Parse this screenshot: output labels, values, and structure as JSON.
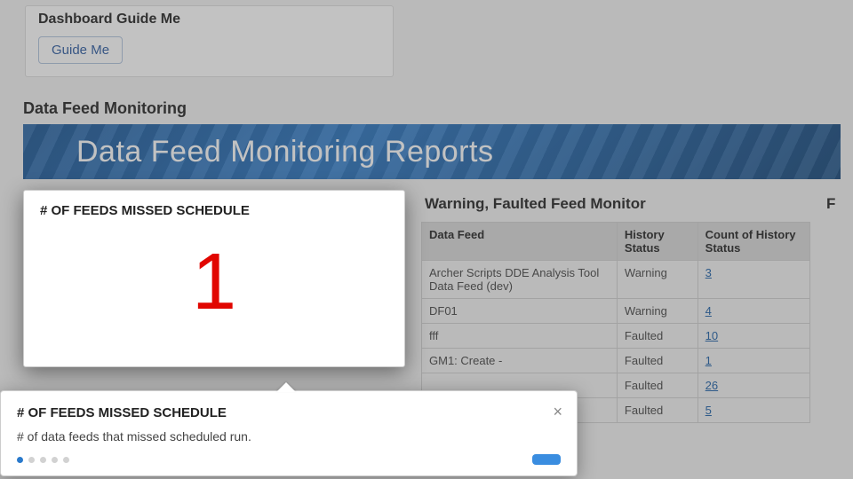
{
  "guide": {
    "card_title": "Dashboard Guide Me",
    "button_label": "Guide Me"
  },
  "section": {
    "title": "Data Feed Monitoring",
    "banner": "Data Feed Monitoring Reports"
  },
  "metric": {
    "title": "# OF FEEDS MISSED SCHEDULE",
    "value": "1"
  },
  "monitor": {
    "title": "Warning, Faulted Feed Monitor",
    "columns": [
      "Data Feed",
      "History Status",
      "Count of History Status"
    ],
    "rows": [
      {
        "feed": "Archer Scripts DDE Analysis Tool Data Feed (dev)",
        "status": "Warning",
        "count": "3"
      },
      {
        "feed": "DF01",
        "status": "Warning",
        "count": "4"
      },
      {
        "feed": "fff",
        "status": "Faulted",
        "count": "10"
      },
      {
        "feed": "GM1: Create -",
        "status": "Faulted",
        "count": "1"
      },
      {
        "feed": "",
        "status": "Faulted",
        "count": "26"
      },
      {
        "feed": "",
        "status": "Faulted",
        "count": "5"
      }
    ]
  },
  "right_card": {
    "title_prefix": "F"
  },
  "popover": {
    "title": "# OF FEEDS MISSED SCHEDULE",
    "body": "# of data feeds that missed scheduled run.",
    "step_count": 5,
    "active_step": 0
  }
}
